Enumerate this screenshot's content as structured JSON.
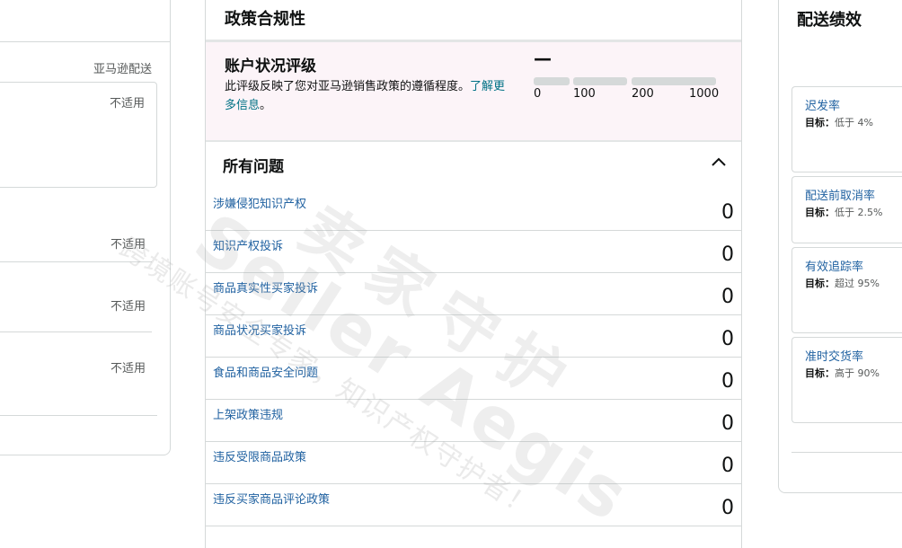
{
  "left_panel": {
    "channel_label": "亚马逊配送",
    "not_applicable": [
      "不适用",
      "不适用",
      "不适用",
      "不适用"
    ]
  },
  "policy": {
    "title": "政策合规性",
    "account_health": {
      "title": "账户状况评级",
      "description": "此评级反映了您对亚马逊销售政策的遵循程度。",
      "link_text": "了解更多信息",
      "link_suffix": "。",
      "value": "—",
      "scale_ticks": [
        "0",
        "100",
        "200",
        "1000"
      ]
    },
    "issues_title": "所有问题",
    "issues": [
      {
        "label": "涉嫌侵犯知识产权",
        "count": "0"
      },
      {
        "label": "知识产权投诉",
        "count": "0"
      },
      {
        "label": "商品真实性买家投诉",
        "count": "0"
      },
      {
        "label": "商品状况买家投诉",
        "count": "0"
      },
      {
        "label": "食品和商品安全问题",
        "count": "0"
      },
      {
        "label": "上架政策违规",
        "count": "0"
      },
      {
        "label": "违反受限商品政策",
        "count": "0"
      },
      {
        "label": "违反买家商品评论政策",
        "count": "0"
      }
    ]
  },
  "shipping": {
    "title": "配送绩效",
    "target_prefix": "目标：",
    "metrics": [
      {
        "name": "迟发率",
        "target": "低于 4%"
      },
      {
        "name": "配送前取消率",
        "target": "低于 2.5%"
      },
      {
        "name": "有效追踪率",
        "target": "超过 95%"
      },
      {
        "name": "准时交货率",
        "target": "高于 90%"
      }
    ]
  },
  "watermark": {
    "brand": "Seller Aegis",
    "brand_cn": "卖家守护",
    "slogan": "跨境账号安全专家，知识产权守护者！"
  }
}
